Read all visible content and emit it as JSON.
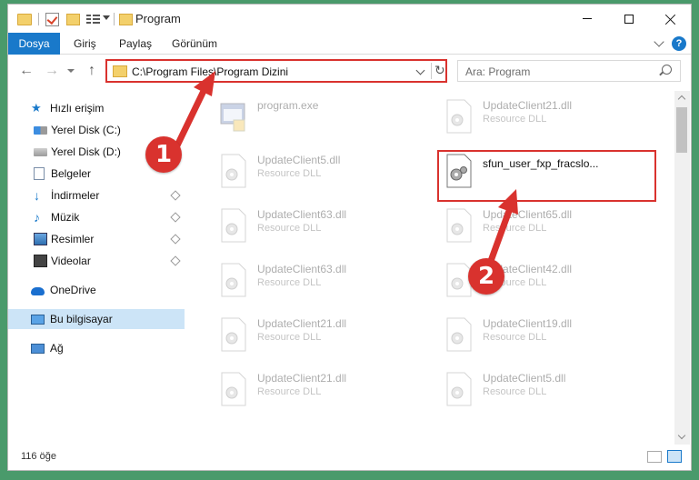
{
  "window": {
    "title": "Program",
    "controls": {
      "minimize": "minimize",
      "maximize": "maximize",
      "close": "close"
    }
  },
  "ribbon": {
    "tabs": [
      {
        "label": "Dosya",
        "active": true
      },
      {
        "label": "Giriş"
      },
      {
        "label": "Paylaş"
      },
      {
        "label": "Görünüm"
      }
    ],
    "help": "?"
  },
  "address": {
    "path": "C:\\Program Files\\Program Dizini",
    "refresh": "↻"
  },
  "search": {
    "placeholder": "Ara: Program"
  },
  "sidebar": {
    "items": [
      {
        "label": "Hızlı erişim",
        "icon": "star-icon"
      },
      {
        "label": "Yerel Disk (C:)",
        "icon": "drive-icon"
      },
      {
        "label": "Yerel Disk (D:)",
        "icon": "drive-icon"
      },
      {
        "label": "Belgeler",
        "icon": "documents-icon"
      },
      {
        "label": "İndirmeler",
        "icon": "downloads-icon"
      },
      {
        "label": "Müzik",
        "icon": "music-icon"
      },
      {
        "label": "Resimler",
        "icon": "pictures-icon"
      },
      {
        "label": "Videolar",
        "icon": "videos-icon"
      },
      {
        "label": "OneDrive",
        "icon": "cloud-icon"
      },
      {
        "label": "Bu bilgisayar",
        "icon": "computer-icon",
        "selected": true
      },
      {
        "label": "Ağ",
        "icon": "network-icon"
      }
    ]
  },
  "files": [
    {
      "name": "program.exe",
      "type": ""
    },
    {
      "name": "UpdateClient21.dll",
      "type": "Resource DLL"
    },
    {
      "name": "UpdateClient5.dll",
      "type": "Resource DLL"
    },
    {
      "name": "sfun_user_fxp_fracslo...",
      "type": ""
    },
    {
      "name": "UpdateClient63.dll",
      "type": "Resource DLL"
    },
    {
      "name": "UpdateClient65.dll",
      "type": "Resource DLL"
    },
    {
      "name": "UpdateClient63.dll",
      "type": "Resource DLL"
    },
    {
      "name": "UpdateClient42.dll",
      "type": "Resource DLL"
    },
    {
      "name": "UpdateClient21.dll",
      "type": "Resource DLL"
    },
    {
      "name": "UpdateClient19.dll",
      "type": "Resource DLL"
    },
    {
      "name": "UpdateClient21.dll",
      "type": "Resource DLL"
    },
    {
      "name": "UpdateClient5.dll",
      "type": "Resource DLL"
    }
  ],
  "status": {
    "count": "116 öğe"
  },
  "annotations": {
    "step1": "1",
    "step2": "2"
  },
  "colors": {
    "accent": "#1979ca",
    "annotation": "#d9322e"
  }
}
